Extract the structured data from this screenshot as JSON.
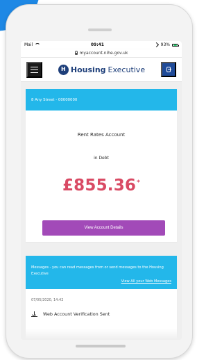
{
  "device": {
    "status_bar": {
      "carrier": "Mail",
      "time": "09:41",
      "battery": "93%",
      "battery_level": 0.93
    },
    "url": "myaccount.nihe.gov.uk"
  },
  "header": {
    "logo_mark": "H",
    "logo_strong": "Housing",
    "logo_light": "Executive",
    "menu_icon": "hamburger-menu-icon",
    "account_icon": "account-icon"
  },
  "account_card": {
    "address": "8 Any Street - 00000000",
    "title": "Rent Rates Account",
    "status": "in Debt",
    "balance": "£855.36",
    "balance_mark": "*",
    "button_label": "View Account Details"
  },
  "messages_card": {
    "banner_text": "Messages - you can read messages from or send messages to the Housing Executive",
    "link_text": "View All your Web Messages",
    "date": "07/05/2020, 14:42",
    "items": [
      {
        "icon": "download-icon",
        "title": "Web Account Verification Sent"
      }
    ]
  },
  "colors": {
    "accent_blue": "#23b7ea",
    "brand_navy": "#1e3f7a",
    "button_purple": "#a24ab8",
    "balance_pink": "#d94a64",
    "corner_blue": "#1e88e5"
  }
}
